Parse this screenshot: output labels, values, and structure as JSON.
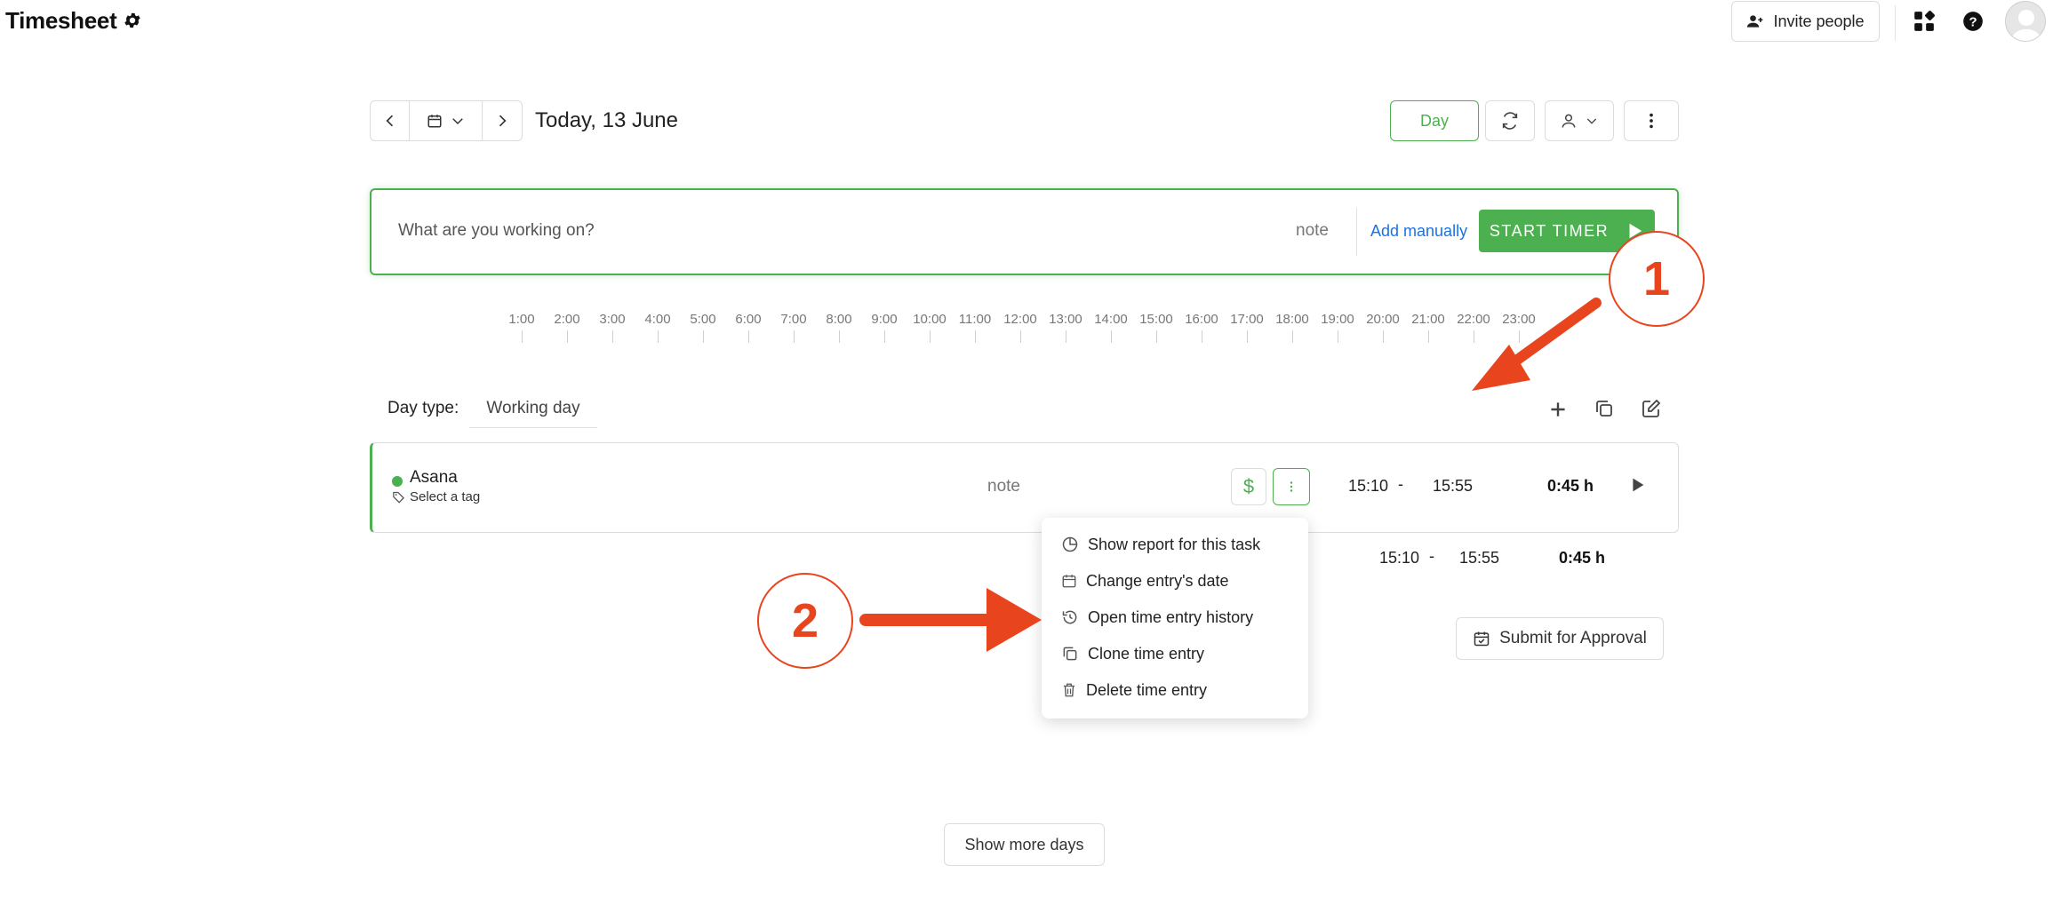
{
  "header": {
    "title": "Timesheet",
    "invite_label": "Invite people"
  },
  "date_nav": {
    "label": "Today, 13 June"
  },
  "view": {
    "day_label": "Day"
  },
  "timer": {
    "placeholder": "What are you working on?",
    "note_label": "note",
    "add_manually_label": "Add manually",
    "start_label": "START TIMER"
  },
  "hours": [
    "1:00",
    "2:00",
    "3:00",
    "4:00",
    "5:00",
    "6:00",
    "7:00",
    "8:00",
    "9:00",
    "10:00",
    "11:00",
    "12:00",
    "13:00",
    "14:00",
    "15:00",
    "16:00",
    "17:00",
    "18:00",
    "19:00",
    "20:00",
    "21:00",
    "22:00",
    "23:00"
  ],
  "day_type": {
    "label": "Day type:",
    "value": "Working day"
  },
  "entry": {
    "project": "Asana",
    "tag": "Select a tag",
    "note": "note",
    "billable_symbol": "$",
    "start": "15:10",
    "dash": "-",
    "end": "15:55",
    "duration": "0:45 h"
  },
  "total": {
    "start": "15:10",
    "dash": "-",
    "end": "15:55",
    "duration": "0:45 h"
  },
  "context_menu": {
    "items": [
      {
        "label": "Show report for this task",
        "icon": "pie-chart-icon"
      },
      {
        "label": "Change entry's date",
        "icon": "calendar-icon"
      },
      {
        "label": "Open time entry history",
        "icon": "history-icon"
      },
      {
        "label": "Clone time entry",
        "icon": "clone-icon"
      },
      {
        "label": "Delete time entry",
        "icon": "trash-icon"
      }
    ]
  },
  "submit_label": "Submit for Approval",
  "more_days_label": "Show more days",
  "annotations": {
    "callout_1": "1",
    "callout_2": "2",
    "color": "#e8451e"
  },
  "colors": {
    "accent_green": "#4caf50",
    "link_blue": "#1a73e8",
    "annotation_orange": "#e8451e"
  }
}
